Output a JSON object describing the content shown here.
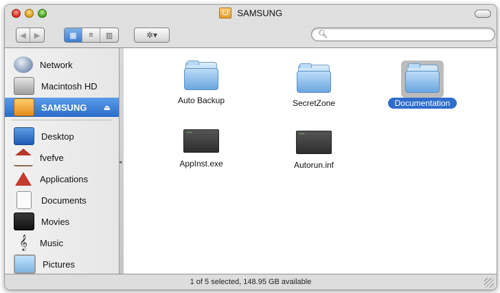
{
  "window": {
    "title": "SAMSUNG"
  },
  "toolbar": {
    "back_glyph": "◀",
    "forward_glyph": "▶",
    "view_icons_glyph": "▦",
    "view_list_glyph": "≡",
    "view_columns_glyph": "▥",
    "action_glyph": "✲▾",
    "search": {
      "value": "",
      "placeholder": ""
    }
  },
  "sidebar": {
    "devices": [
      {
        "label": "Network",
        "icon": "network-icon"
      },
      {
        "label": "Macintosh HD",
        "icon": "hard-drive-icon"
      },
      {
        "label": "SAMSUNG",
        "icon": "usb-drive-icon",
        "selected": true,
        "eject_glyph": "⏏"
      }
    ],
    "places": [
      {
        "label": "Desktop",
        "icon": "desktop-icon"
      },
      {
        "label": "fvefve",
        "icon": "home-icon"
      },
      {
        "label": "Applications",
        "icon": "applications-icon"
      },
      {
        "label": "Documents",
        "icon": "documents-icon"
      },
      {
        "label": "Movies",
        "icon": "movies-icon"
      },
      {
        "label": "Music",
        "icon": "music-icon",
        "glyph": "𝄞"
      },
      {
        "label": "Pictures",
        "icon": "pictures-icon"
      }
    ]
  },
  "files": [
    {
      "name": "Auto Backup",
      "type": "folder",
      "selected": false
    },
    {
      "name": "SecretZone",
      "type": "folder",
      "selected": false
    },
    {
      "name": "Documentation",
      "type": "folder",
      "selected": true
    },
    {
      "name": "AppInst.exe",
      "type": "executable",
      "selected": false
    },
    {
      "name": "Autorun.inf",
      "type": "executable",
      "selected": false
    }
  ],
  "status": {
    "text": "1 of 5 selected, 148.95 GB available"
  },
  "colors": {
    "selection": "#2f6dcb",
    "sidebar_selection": "#2a6cc9"
  }
}
